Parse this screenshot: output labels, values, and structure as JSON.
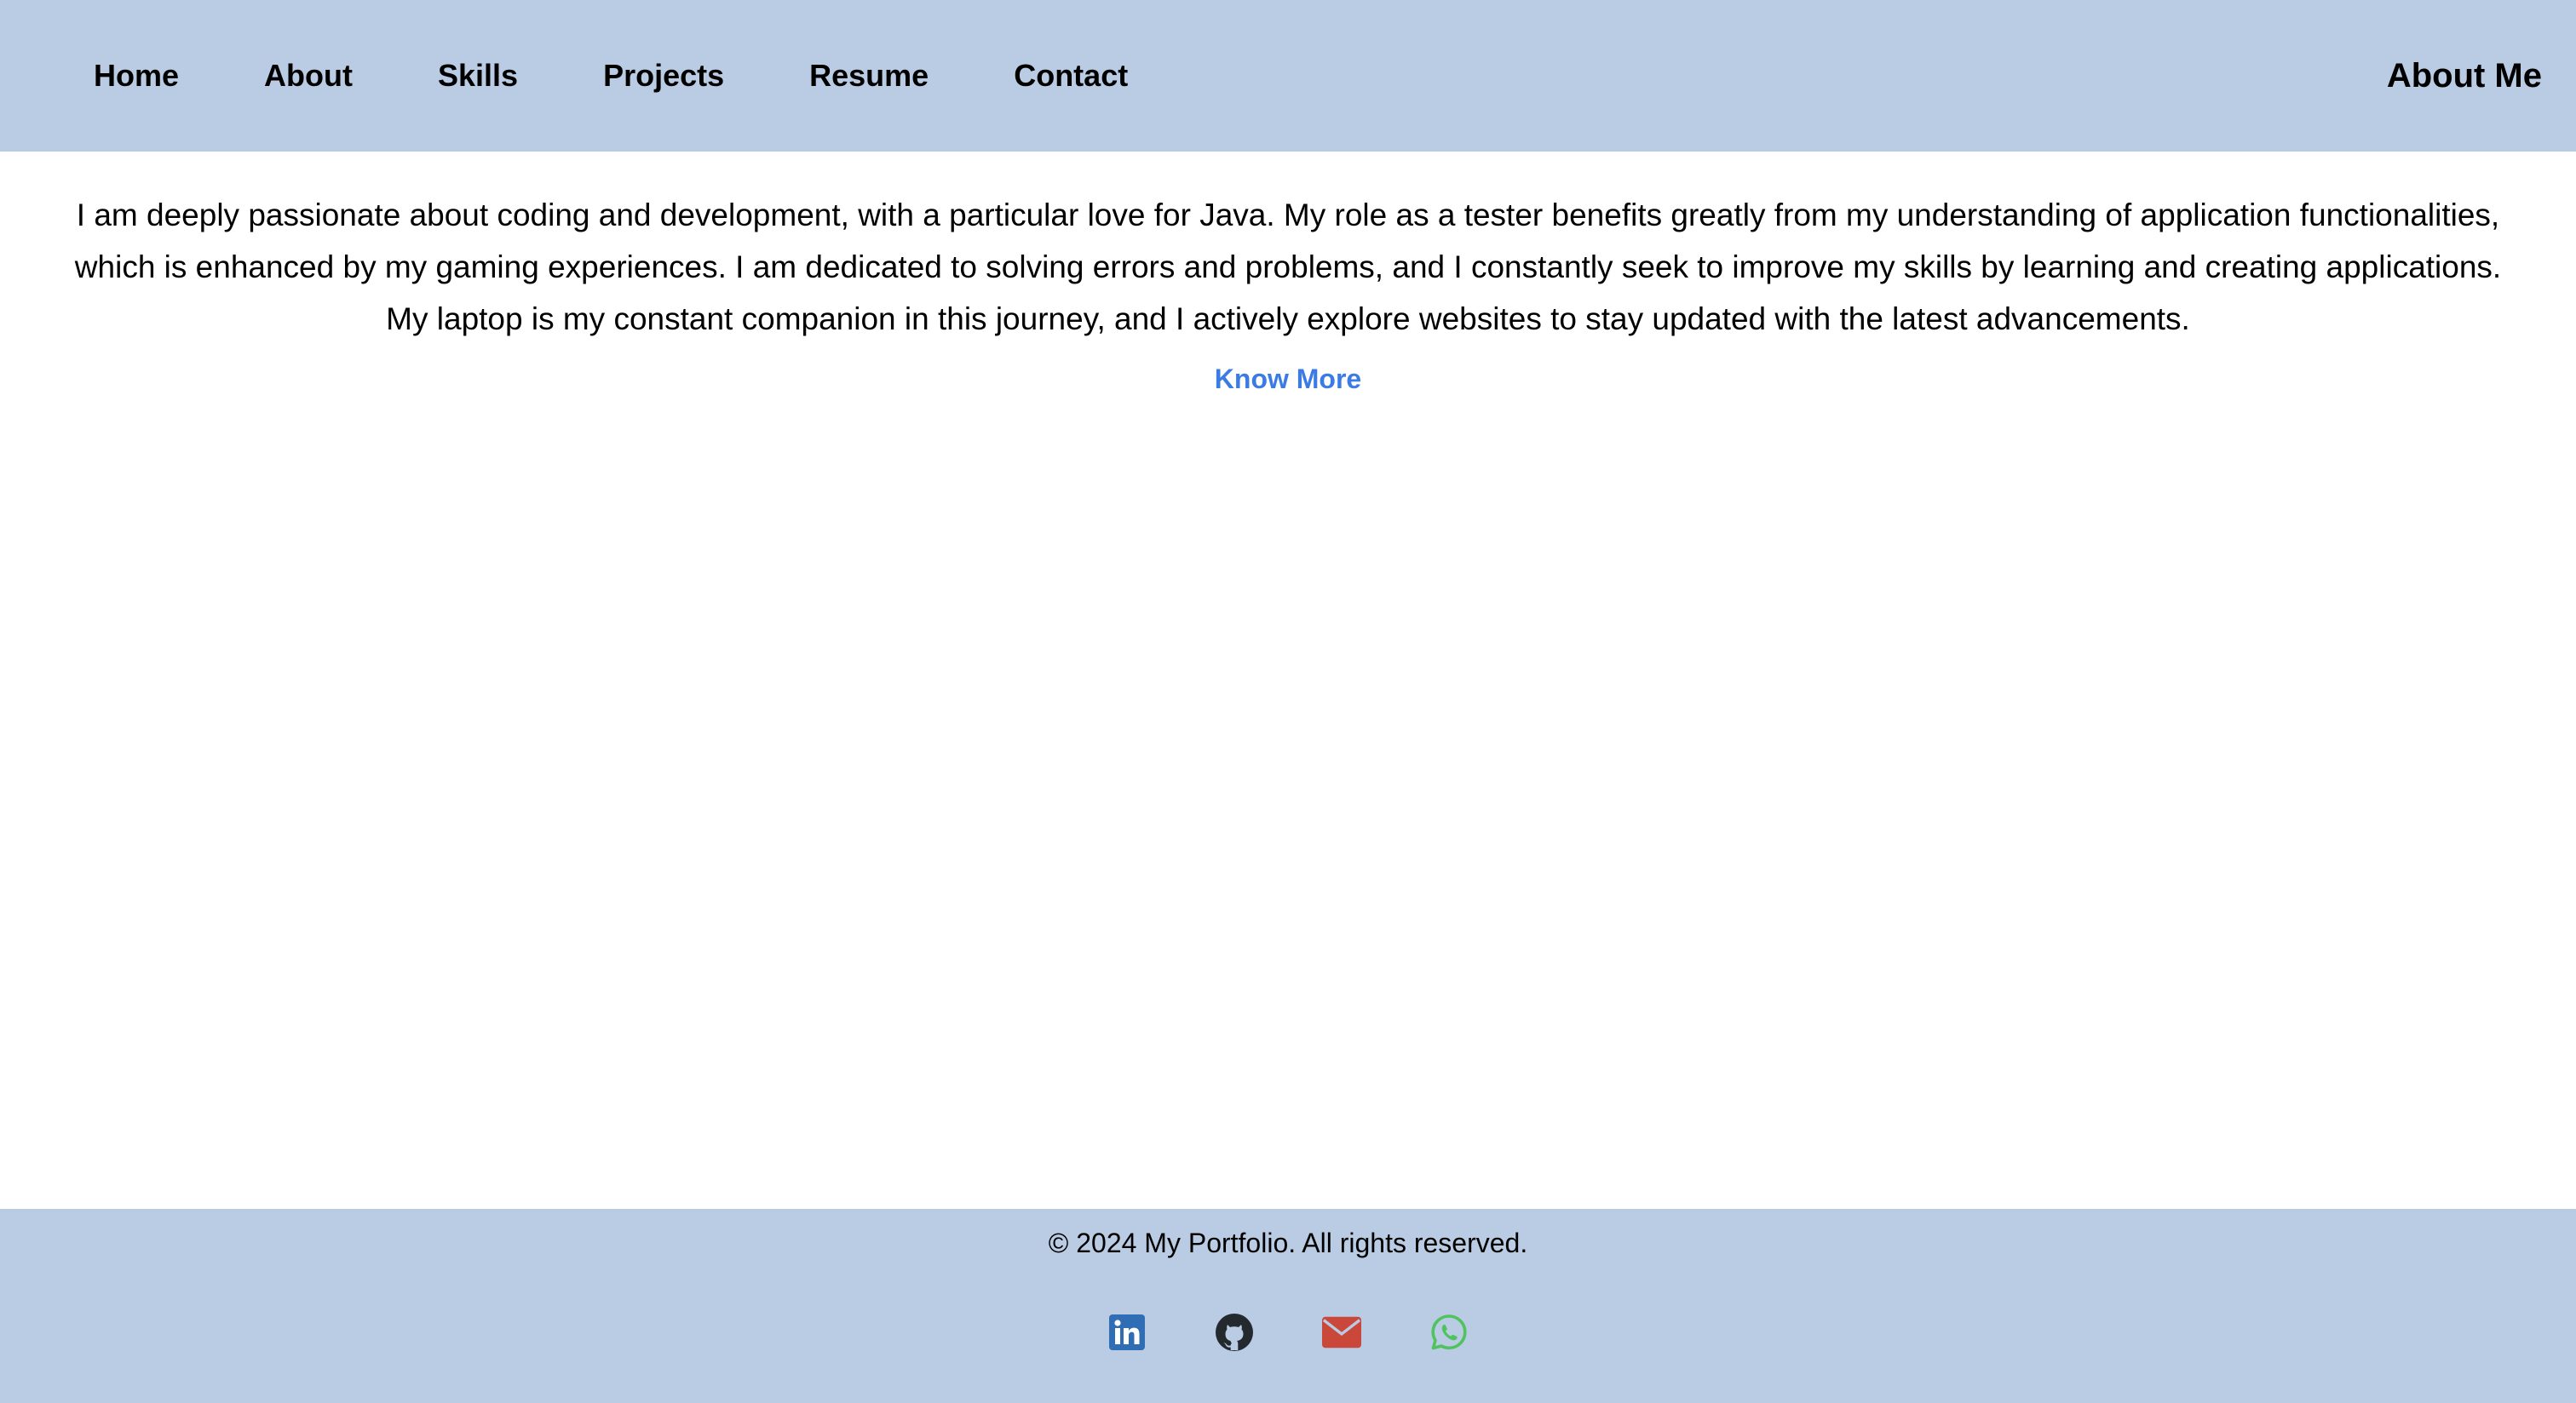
{
  "nav": {
    "items": [
      {
        "label": "Home"
      },
      {
        "label": "About"
      },
      {
        "label": "Skills"
      },
      {
        "label": "Projects"
      },
      {
        "label": "Resume"
      },
      {
        "label": "Contact"
      }
    ]
  },
  "header": {
    "title": "About Me"
  },
  "about": {
    "text": "I am deeply passionate about coding and development, with a particular love for Java. My role as a tester benefits greatly from my understanding of application functionalities, which is enhanced by my gaming experiences. I am dedicated to solving errors and problems, and I constantly seek to improve my skills by learning and creating applications. My laptop is my constant companion in this journey, and I actively explore websites to stay updated with the latest advancements.",
    "link_label": "Know More"
  },
  "footer": {
    "copyright": "© 2024 My Portfolio. All rights reserved.",
    "socials": [
      {
        "icon": "linkedin-icon",
        "color": "#2f6eb5"
      },
      {
        "icon": "github-icon",
        "color": "#24292e"
      },
      {
        "icon": "email-icon",
        "color": "#c9483a"
      },
      {
        "icon": "whatsapp-icon",
        "color": "#4fc35e"
      }
    ]
  },
  "colors": {
    "header_bg": "#bacbe4",
    "footer_bg": "#bacbe4",
    "link": "#3b7be4"
  }
}
